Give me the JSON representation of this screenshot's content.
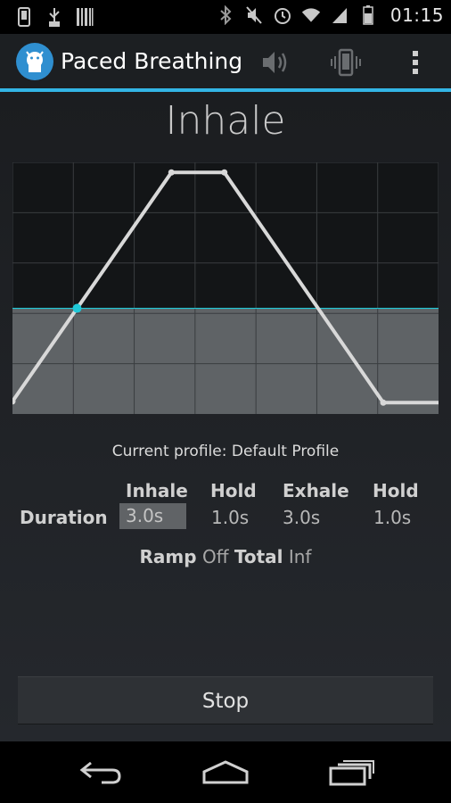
{
  "status_bar": {
    "time": "01:15",
    "left_icons": [
      "phone-icon",
      "usb-debug-icon",
      "barcode-icon"
    ],
    "right_icons": [
      "bluetooth-icon",
      "mute-icon",
      "alarm-icon",
      "wifi-icon",
      "signal-icon",
      "battery-icon"
    ]
  },
  "action_bar": {
    "title": "Paced Breathing",
    "actions": [
      "volume-icon",
      "vibrate-icon",
      "overflow-menu-icon"
    ]
  },
  "phase": {
    "label": "Inhale"
  },
  "breath_chart": {
    "type": "line",
    "segments": [
      "inhale",
      "hold",
      "exhale",
      "hold"
    ],
    "durations_s": [
      3.0,
      1.0,
      3.0,
      1.0
    ],
    "progress_level": 0.42,
    "colors": {
      "line": "#d8d8d8",
      "progress": "#1fc8d8",
      "fill": "#5f6366",
      "grid": "#3a3d40"
    }
  },
  "profile": {
    "text": "Current profile: Default Profile"
  },
  "table": {
    "headers": [
      "Inhale",
      "Hold",
      "Exhale",
      "Hold"
    ],
    "row_label": "Duration",
    "values": [
      "3.0s",
      "1.0s",
      "3.0s",
      "1.0s"
    ]
  },
  "ramp": {
    "ramp_label": "Ramp",
    "ramp_value": "Off",
    "total_label": "Total",
    "total_value": "Inf"
  },
  "stop_button": {
    "label": "Stop"
  },
  "nav_bar": {
    "buttons": [
      "back-icon",
      "home-icon",
      "recent-apps-icon"
    ]
  },
  "colors": {
    "accent": "#33b5e5",
    "background": "#1f2226"
  }
}
